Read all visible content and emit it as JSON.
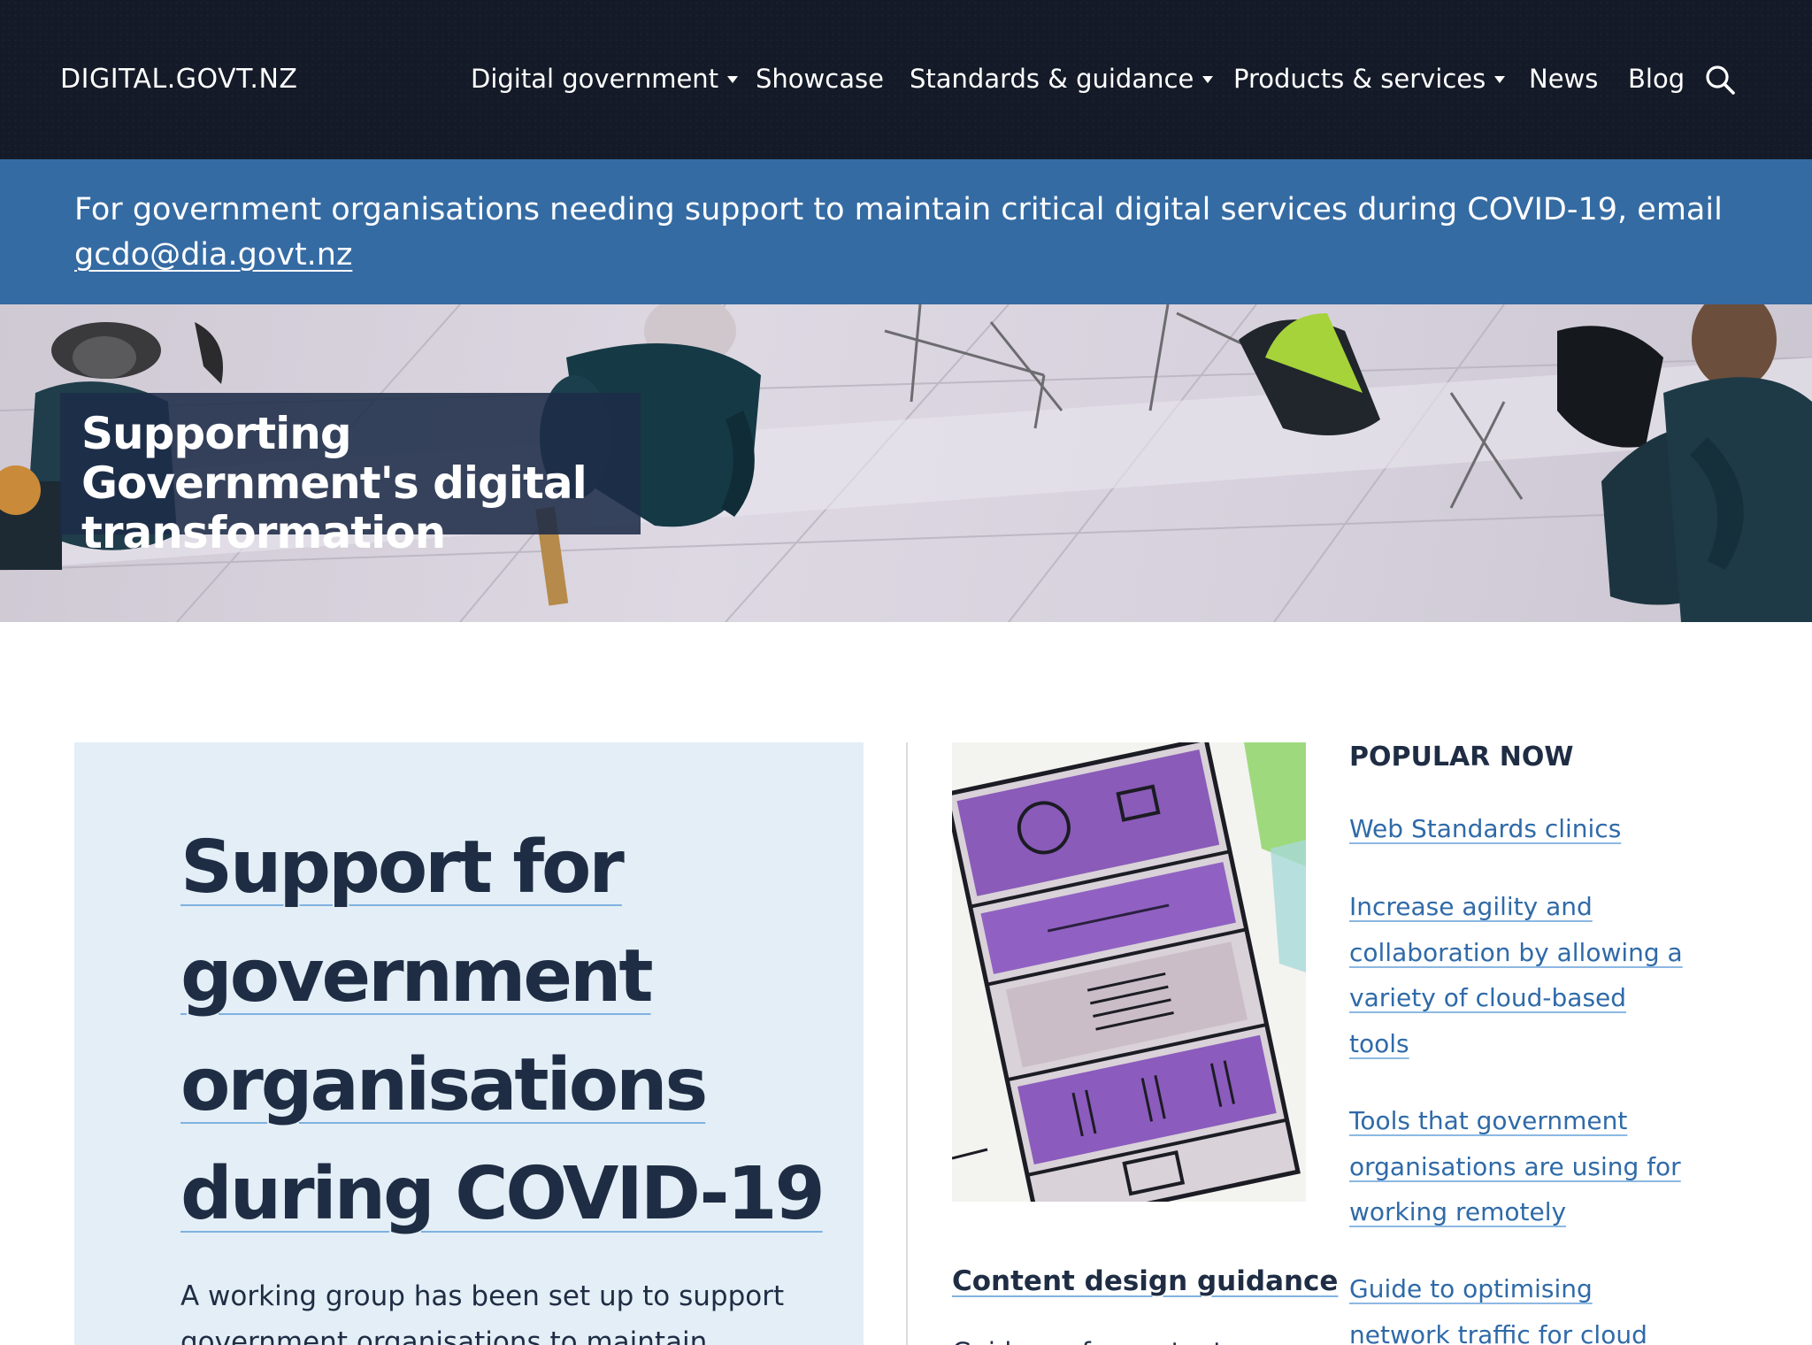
{
  "header": {
    "logo": "DIGITAL.GOVT.NZ",
    "nav": [
      {
        "label": "Digital government",
        "has_dropdown": true
      },
      {
        "label": "Showcase",
        "has_dropdown": false
      },
      {
        "label": "Standards & guidance",
        "has_dropdown": true
      },
      {
        "label": "Products & services",
        "has_dropdown": true
      },
      {
        "label": "News",
        "has_dropdown": false
      },
      {
        "label": "Blog",
        "has_dropdown": false
      }
    ],
    "search_icon": "search-icon"
  },
  "alert": {
    "text": "For government organisations needing support to maintain critical digital services during COVID-19, email ",
    "email": "gcdo@dia.govt.nz"
  },
  "hero": {
    "title": "Supporting Government's digital transformation"
  },
  "feature": {
    "title_lines": [
      "Support for",
      "government",
      "organisations",
      "during COVID-19"
    ],
    "description": "A working group has been set up to support government organisations to maintain"
  },
  "content_design": {
    "title": "Content design guidance",
    "description": "Guidance for content"
  },
  "popular": {
    "heading": "POPULAR NOW",
    "items": [
      {
        "lines": [
          "Web Standards clinics"
        ]
      },
      {
        "lines": [
          "Increase agility and",
          "collaboration by allowing a",
          "variety of cloud-based",
          "tools"
        ]
      },
      {
        "lines": [
          "Tools that government",
          "organisations are using for",
          "working remotely"
        ]
      },
      {
        "lines": [
          "Guide to optimising",
          "network traffic for cloud"
        ]
      }
    ]
  },
  "colors": {
    "header_bg": "#141a27",
    "alert_bg": "#356ba3",
    "feature_bg": "#e3eef6",
    "link": "#2f6aa8",
    "heading": "#1f2d44"
  }
}
